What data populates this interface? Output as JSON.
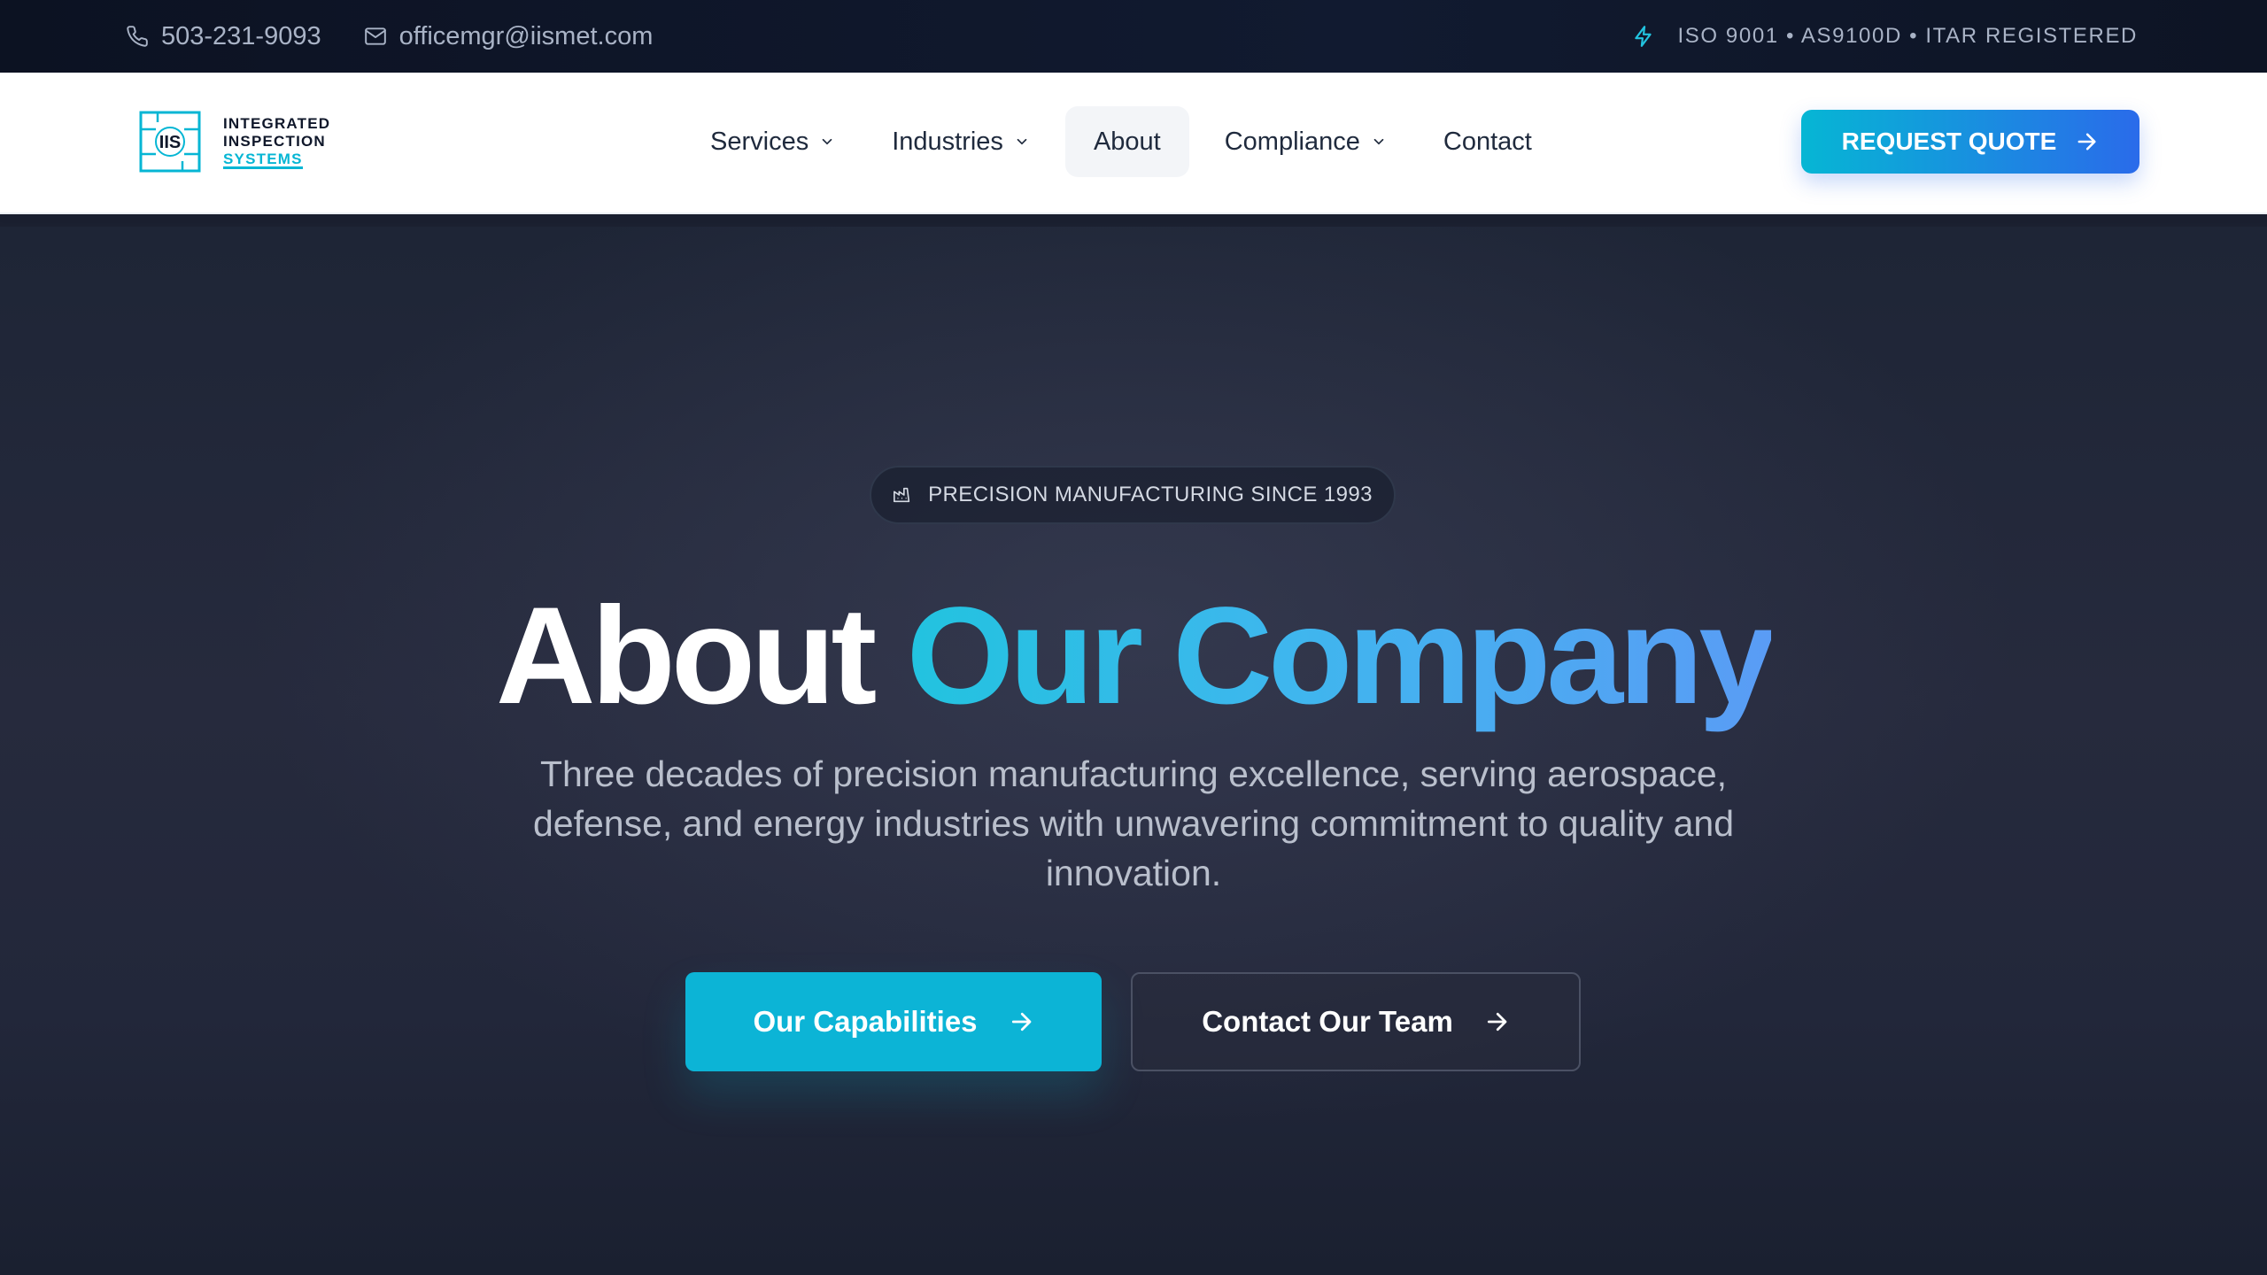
{
  "topbar": {
    "phone": "503-231-9093",
    "email": "officemgr@iismet.com",
    "certifications": "ISO 9001 • AS9100D • ITAR REGISTERED",
    "icons": [
      "phone-icon",
      "mail-icon",
      "lightning-icon"
    ]
  },
  "logo": {
    "mark": "IIS",
    "line1": "INTEGRATED",
    "line2": "INSPECTION",
    "line3": "SYSTEMS"
  },
  "nav": {
    "items": [
      {
        "label": "Services",
        "has_dropdown": true
      },
      {
        "label": "Industries",
        "has_dropdown": true
      },
      {
        "label": "About",
        "has_dropdown": false,
        "active": true
      },
      {
        "label": "Compliance",
        "has_dropdown": true
      },
      {
        "label": "Contact",
        "has_dropdown": false
      }
    ],
    "cta": "REQUEST QUOTE"
  },
  "hero": {
    "badge": "PRECISION MANUFACTURING SINCE 1993",
    "title_white": "About",
    "title_gradient": "Our Company",
    "subtitle": "Three decades of precision manufacturing excellence, serving aerospace, defense, and energy industries with unwavering commitment to quality and innovation.",
    "primary_button": "Our Capabilities",
    "secondary_button": "Contact Our Team"
  },
  "colors": {
    "accent": "#06b6d4",
    "accent_blue": "#2563eb",
    "dark_bg": "#0c1222",
    "hero_bg": "#242a3c"
  }
}
